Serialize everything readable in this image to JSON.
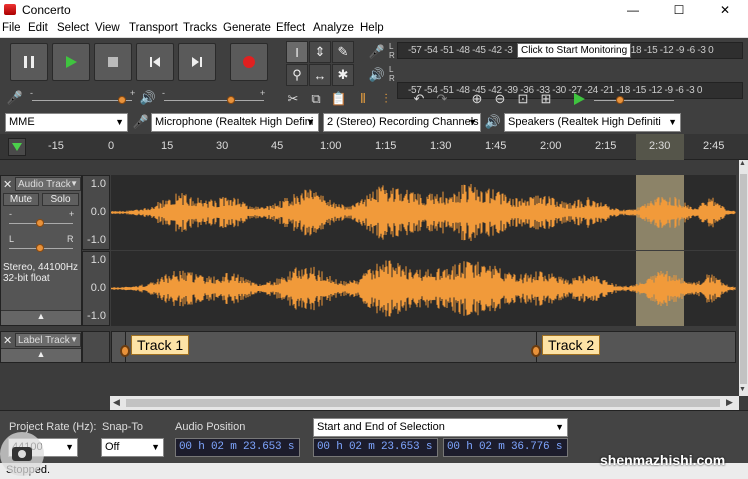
{
  "window": {
    "title": "Concerto",
    "minimize": "—",
    "maximize": "☐",
    "close": "✕"
  },
  "menu": [
    "File",
    "Edit",
    "Select",
    "View",
    "Transport",
    "Tracks",
    "Generate",
    "Effect",
    "Analyze",
    "Help"
  ],
  "meters": {
    "record_scale": "-57 -54 -51 -48 -45 -42 -3",
    "record_scale_right": "1 -18 -15 -12 -9 -6 -3 0",
    "tooltip": "Click to Start Monitoring",
    "play_scale": "-57 -54 -51 -48 -45 -42 -39 -36 -33 -30 -27 -24 -21 -18 -15 -12 -9 -6 -3 0",
    "channel_l": "L",
    "channel_r": "R"
  },
  "devices": {
    "host": "MME",
    "microphone": "Microphone (Realtek High Defini",
    "channels": "2 (Stereo) Recording Channels",
    "speakers": "Speakers (Realtek High Definiti"
  },
  "ruler": [
    "-15",
    "0",
    "15",
    "30",
    "45",
    "1:00",
    "1:15",
    "1:30",
    "1:45",
    "2:00",
    "2:15",
    "2:30",
    "2:45"
  ],
  "audio_track": {
    "name": "Audio Track",
    "mute": "Mute",
    "solo": "Solo",
    "pan_l": "L",
    "pan_r": "R",
    "gain_minus": "-",
    "gain_plus": "+",
    "info_line1": "Stereo, 44100Hz",
    "info_line2": "32-bit float",
    "scale": [
      "1.0",
      "0.0",
      "-1.0"
    ],
    "wave_color": "#f19a3a",
    "selection_color": "#8c8368"
  },
  "label_track": {
    "name": "Label Track",
    "labels": [
      "Track 1",
      "Track 2"
    ]
  },
  "bottom": {
    "project_rate_label": "Project Rate (Hz):",
    "project_rate_value": "44100",
    "snap_label": "Snap-To",
    "snap_value": "Off",
    "audio_position_label": "Audio Position",
    "audio_position": "00 h 02 m 23.653 s",
    "selection_mode": "Start and End of Selection",
    "selection_start": "00 h 02 m 23.653 s",
    "selection_end": "00 h 02 m 36.776 s"
  },
  "status": "Stopped.",
  "watermark": "shenmazhishi.com"
}
